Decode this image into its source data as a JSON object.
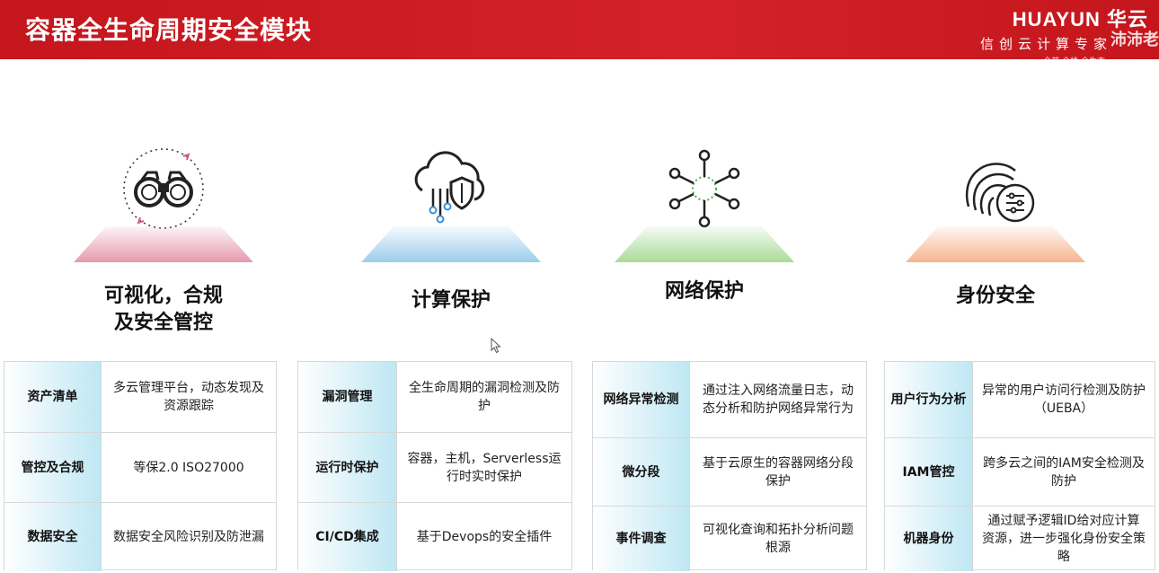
{
  "header": {
    "title": "容器全生命周期安全模块",
    "brand_name": "HUAYUN 华云",
    "brand_sub": "信创云计算专家",
    "brand_slogan": "全芯·全栈·全生态",
    "watermark": "沛沛老"
  },
  "colors": {
    "header_red": "#c4161c",
    "stage_pink": "#e79aae",
    "stage_blue": "#9ccdec",
    "stage_green": "#a9db97",
    "stage_orange": "#f6b58f",
    "key_cyan": "#bfe7f3"
  },
  "columns": [
    {
      "title_line1": "可视化，合规",
      "title_line2": "及安全管控",
      "icon": "binoculars-icon",
      "rows": [
        {
          "key": "资产清单",
          "value": "多云管理平台，动态发现及资源跟踪"
        },
        {
          "key": "管控及合规",
          "value": "等保2.0 ISO27000"
        },
        {
          "key": "数据安全",
          "value": "数据安全风险识别及防泄漏"
        }
      ]
    },
    {
      "title_line1": "计算保护",
      "title_line2": "",
      "icon": "cloud-shield-icon",
      "rows": [
        {
          "key": "漏洞管理",
          "value": "全生命周期的漏洞检测及防护"
        },
        {
          "key": "运行时保护",
          "value": "容器，主机，Serverless运行时实时保护"
        },
        {
          "key": "CI/CD集成",
          "value": "基于Devops的安全插件"
        }
      ]
    },
    {
      "title_line1": "网络保护",
      "title_line2": "",
      "icon": "network-hub-icon",
      "rows": [
        {
          "key": "网络异常检测",
          "value": "通过注入网络流量日志，动态分析和防护网络异常行为"
        },
        {
          "key": "微分段",
          "value": "基于云原生的容器网络分段保护"
        },
        {
          "key": "事件调查",
          "value": "可视化查询和拓扑分析问题根源"
        }
      ]
    },
    {
      "title_line1": "身份安全",
      "title_line2": "",
      "icon": "fingerprint-icon",
      "rows": [
        {
          "key": "用户行为分析",
          "value": "异常的用户访问行检测及防护（UEBA）"
        },
        {
          "key": "IAM管控",
          "value": "跨多云之间的IAM安全检测及防护"
        },
        {
          "key": "机器身份",
          "value": "通过赋予逻辑ID给对应计算资源，进一步强化身份安全策略"
        }
      ]
    }
  ]
}
